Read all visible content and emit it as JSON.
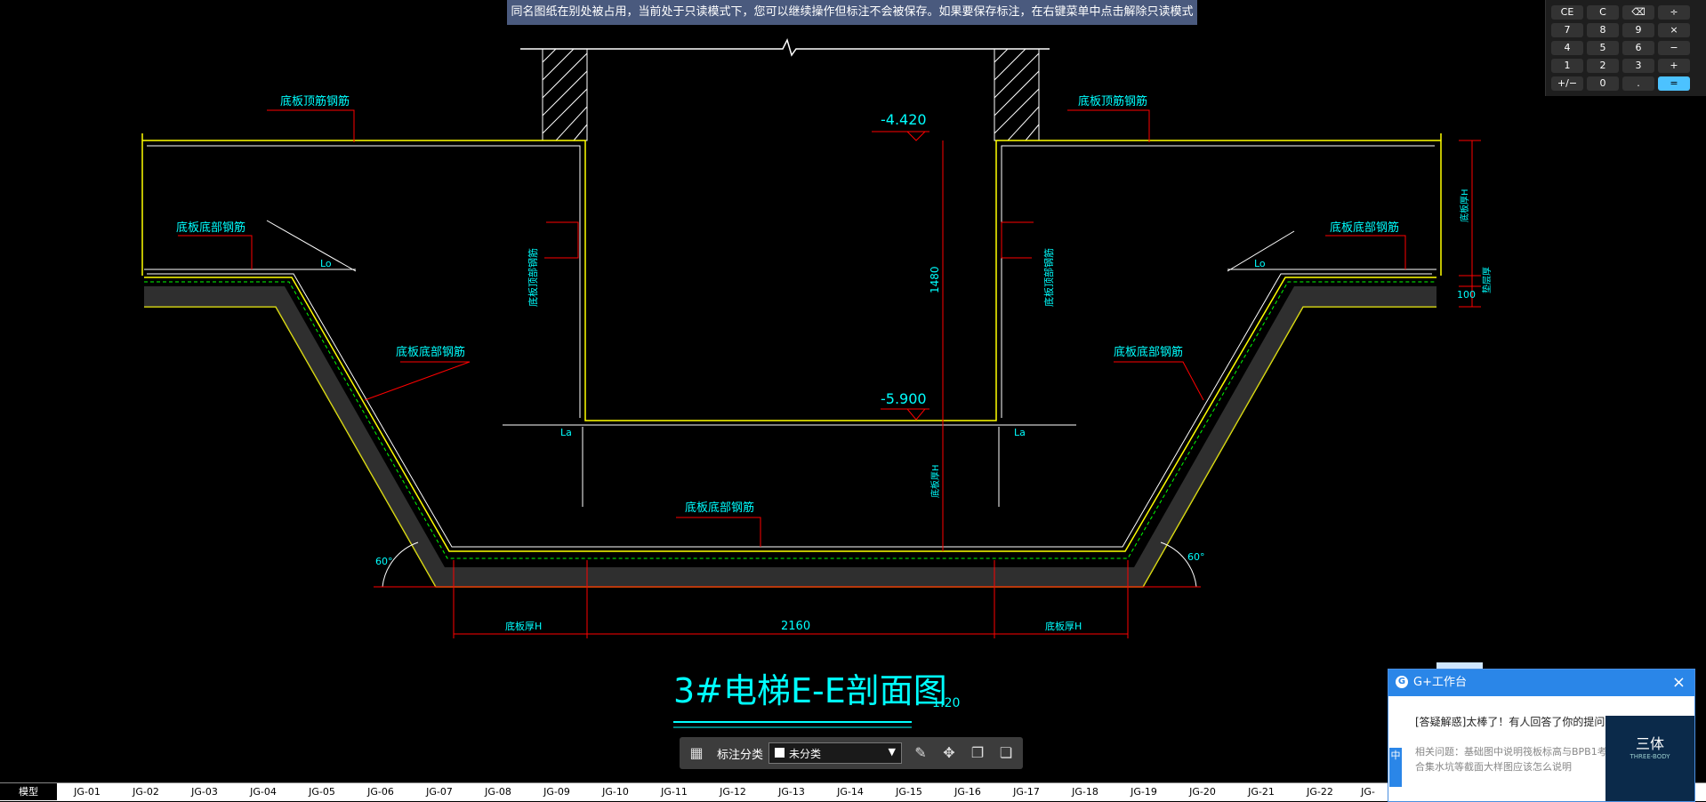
{
  "banner": {
    "text": "同名图纸在别处被占用，当前处于只读模式下，您可以继续操作但标注不会被保存。如果要保存标注，在右键菜单中点击解除只读模式"
  },
  "calculator": {
    "keys": [
      [
        "CE",
        "C",
        "⌫",
        "÷"
      ],
      [
        "7",
        "8",
        "9",
        "×"
      ],
      [
        "4",
        "5",
        "6",
        "−"
      ],
      [
        "1",
        "2",
        "3",
        "+"
      ],
      [
        "+/−",
        "0",
        ".",
        "="
      ]
    ]
  },
  "drawing": {
    "title": "3#电梯E-E剖面图",
    "scale": "1:20",
    "labels": {
      "top_left": "底板顶筋钢筋",
      "top_right": "底板顶筋钢筋",
      "mid_left": "底板底部钢筋",
      "mid_right": "底板底部钢筋",
      "slope_left": "底板底部钢筋",
      "slope_right": "底板底部钢筋",
      "bottom": "底板底部钢筋",
      "wall_left": "底板顶部钢筋",
      "wall_right": "底板顶部钢筋",
      "elev_top": "-4.420",
      "elev_bottom": "-5.900",
      "dim_depth": "1480",
      "dim_width": "2160",
      "dim_h_left": "底板厚H",
      "dim_h_right": "底板厚H",
      "dim_h_vert": "底板厚H",
      "right_h": "底板厚H",
      "right_cushion": "垫层厚",
      "right_100": "100",
      "angle_left": "60°",
      "angle_right": "60°",
      "la": "La",
      "lo": "Lo"
    }
  },
  "toolbar": {
    "label": "标注分类",
    "select_value": "未分类"
  },
  "tabs": [
    "模型",
    "JG-01",
    "JG-02",
    "JG-03",
    "JG-04",
    "JG-05",
    "JG-06",
    "JG-07",
    "JG-08",
    "JG-09",
    "JG-10",
    "JG-11",
    "JG-12",
    "JG-13",
    "JG-14",
    "JG-15",
    "JG-16",
    "JG-17",
    "JG-18",
    "JG-19",
    "JG-20",
    "JG-21",
    "JG-22",
    "JG-"
  ],
  "gplus": {
    "title": "G+工作台",
    "message": "[答疑解惑]太棒了！有人回答了你的提问",
    "related": "相关问题：基础图中说明筏板标高与BPB1考结合集水坑等截面大样图应该怎么说明",
    "ad_title": "三体",
    "ad_sub": "THREE-BODY",
    "side": "中"
  },
  "colors": {
    "bg": "#000000",
    "yellow": "#ffff00",
    "cyan": "#00ffff",
    "red": "#ff0000",
    "white": "#ffffff",
    "green": "#00ff00"
  }
}
